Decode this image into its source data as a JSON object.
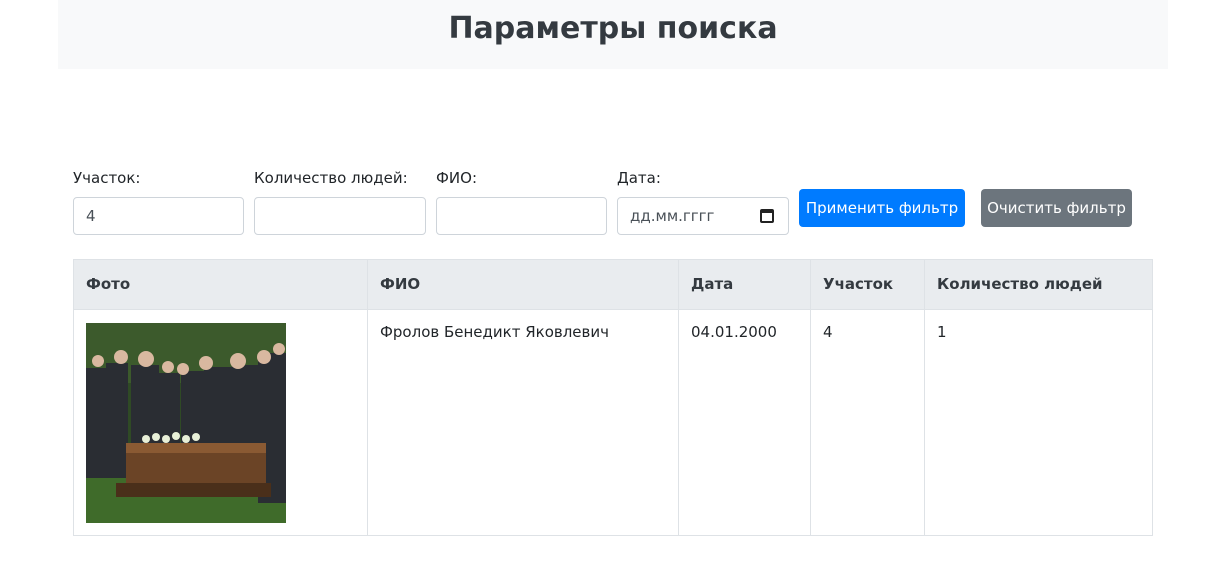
{
  "header": {
    "title": "Параметры поиска"
  },
  "filters": {
    "plot_label": "Участок:",
    "plot_value": "4",
    "people_label": "Количество людей:",
    "people_value": "",
    "name_label": "ФИО:",
    "name_value": "",
    "date_label": "Дата:",
    "date_placeholder": "дд.мм.гггг",
    "apply_label": "Применить фильтр",
    "clear_label": "Очистить фильтр"
  },
  "table": {
    "headers": [
      "Фото",
      "ФИО",
      "Дата",
      "Участок",
      "Количество людей"
    ],
    "rows": [
      {
        "photo": "funeral-photo",
        "name": "Фролов Бенедикт Яковлевич",
        "date": "04.01.2000",
        "plot": "4",
        "people": "1"
      }
    ]
  },
  "colors": {
    "primary": "#007bff",
    "secondary": "#6c757d",
    "header_bg": "#f8f9fa",
    "table_head_bg": "#e9ecef"
  }
}
